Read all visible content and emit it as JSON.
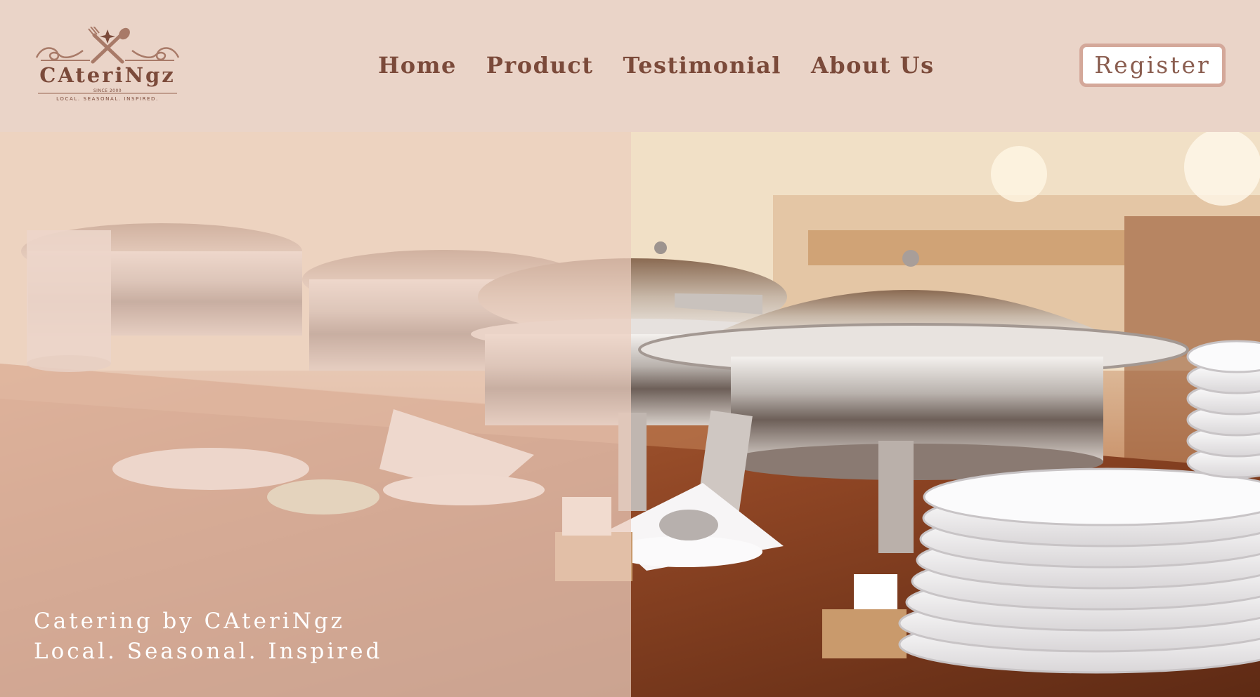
{
  "logo": {
    "name": "CAteriNgz",
    "since": "SINCE 2000",
    "tagline": "LOCAL. SEASONAL. INSPIRED."
  },
  "nav": {
    "items": [
      {
        "label": "Home"
      },
      {
        "label": "Product"
      },
      {
        "label": "Testimonial"
      },
      {
        "label": "About Us"
      }
    ]
  },
  "register": {
    "label": "Register"
  },
  "hero": {
    "caption_line1": "Catering by CAteriNgz",
    "caption_line2": "Local. Seasonal. Inspired",
    "image_subject": "buffet chafing dishes and stacked plates"
  },
  "colors": {
    "header_bg": "#ead4c8",
    "brand_brown": "#7b4a3a",
    "register_border": "#d4a89a",
    "overlay": "#eccdbe"
  }
}
